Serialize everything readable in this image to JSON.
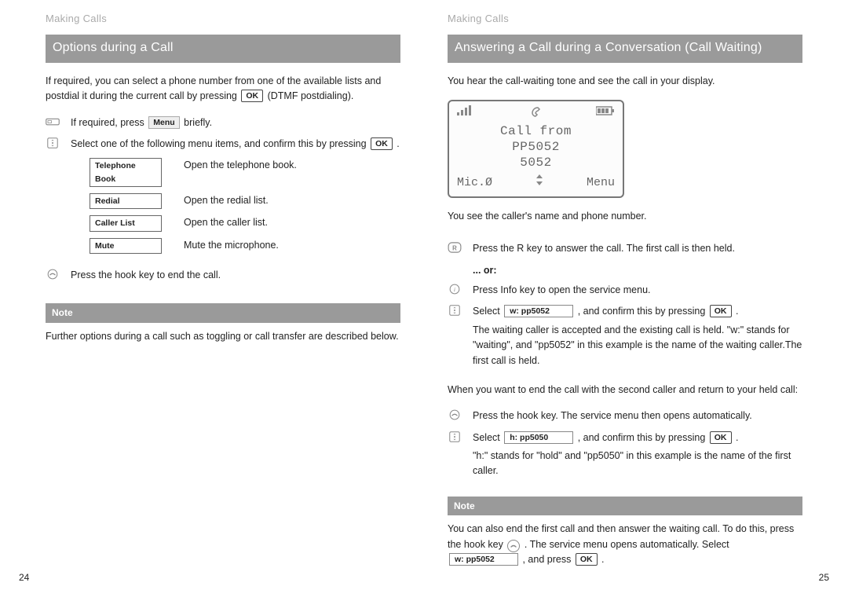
{
  "left": {
    "running_head": "Making Calls",
    "section_title": "Options during a Call",
    "intro_a": "If required, you can select a phone number from one of the available lists and postdial it during the current call by pressing ",
    "intro_b": " (DTMF postdialing).",
    "key_ok": "OK",
    "key_menu": "Menu",
    "step1_a": "If required, press ",
    "step1_b": " briefly.",
    "step2_a": "Select one of the following menu items, and confirm this by pressing ",
    "step2_b": " .",
    "menu": [
      {
        "label": "Telephone Book",
        "desc": "Open the telephone book."
      },
      {
        "label": "Redial",
        "desc": "Open the redial list."
      },
      {
        "label": "Caller List",
        "desc": "Open the caller list."
      },
      {
        "label": "Mute",
        "desc": "Mute the microphone."
      }
    ],
    "step3": "Press the hook key to end the call.",
    "note_label": "Note",
    "note_text": "Further options during a call such as toggling or call transfer are described below.",
    "page_num": "24"
  },
  "right": {
    "running_head": "Making Calls",
    "section_title": "Answering a Call during a Conversation (Call Waiting)",
    "intro": "You hear the call-waiting tone and see the call in your display.",
    "lcd": {
      "line1": "Call from",
      "line2": "PP5052",
      "line3": "5052",
      "left": "Mic.Ø",
      "right": "Menu"
    },
    "caller_line": "You see the caller's name and phone number.",
    "stepR_a": "Press the R key to answer the call. The first call is then held.",
    "or_label": "... or:",
    "stepInfo": "Press Info key to open the service menu.",
    "select1_a": "Select ",
    "select1_val": "w: pp5052",
    "select1_b": " , and confirm this by pressing ",
    "select1_c": " .",
    "select1_expl": "The waiting caller is accepted and the existing call is held. \"w:\" stands for \"waiting\", and \"pp5052\" in this example is the name of the waiting caller.The first call is held.",
    "return_intro": "When you want to end the call with the second caller and return to your held call:",
    "stepHook": "Press the hook key. The service menu then opens automatically.",
    "select2_a": "Select ",
    "select2_val": "h: pp5050",
    "select2_b": " , and confirm this by pressing ",
    "select2_c": " .",
    "select2_expl": "\"h:\" stands for \"hold\" and \"pp5050\" in this example is the name of the first caller.",
    "note_label": "Note",
    "note_a": "You can also end the first call and then answer the waiting call. To do this, press the hook key ",
    "note_b": " . The service menu opens automatically. Select ",
    "note_sel": "w: pp5052",
    "note_c": " , and press ",
    "note_d": " .",
    "key_ok": "OK",
    "page_num": "25"
  }
}
